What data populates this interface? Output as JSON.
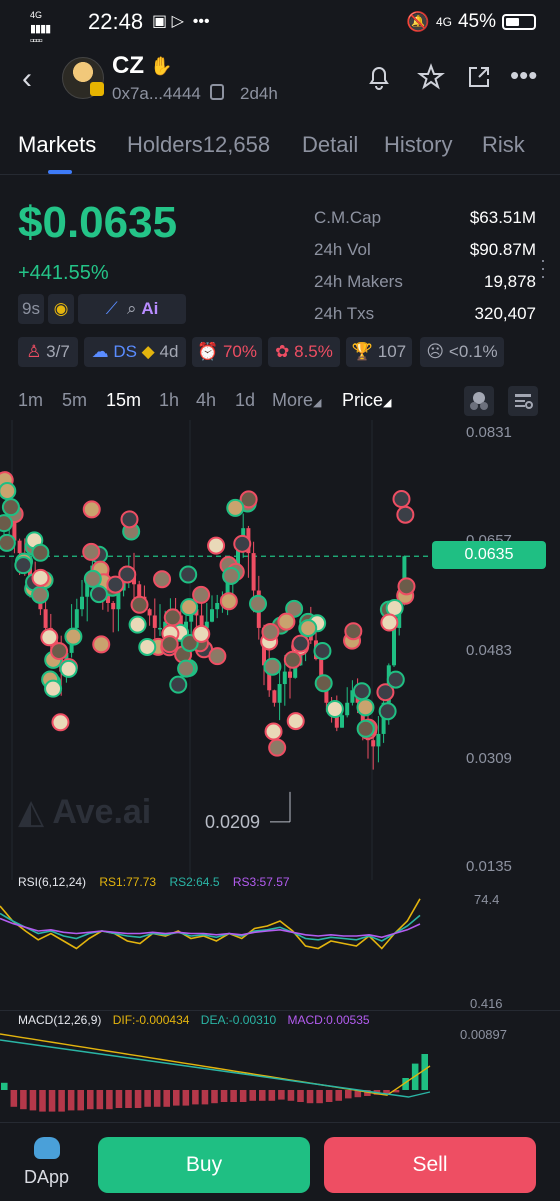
{
  "status_bar": {
    "network": "4G",
    "time": "22:48",
    "network_right": "4G",
    "battery": "45%"
  },
  "header": {
    "name": "CZ",
    "address": "0x7a...4444",
    "age": "2d4h"
  },
  "tabs": [
    "Markets",
    "Holders12,658",
    "Detail",
    "History",
    "Risk"
  ],
  "market": {
    "price": "$0.0635",
    "change": "+441.55%",
    "stats": [
      {
        "label": "C.M.Cap",
        "value": "$63.51M"
      },
      {
        "label": "24h Vol",
        "value": "$90.87M"
      },
      {
        "label": "24h Makers",
        "value": "19,878"
      },
      {
        "label": "24h Txs",
        "value": "320,407"
      }
    ]
  },
  "badges": {
    "age_badge": "9s",
    "ai_label": "Ai",
    "holders_ratio": "3/7",
    "ds_label": "DS",
    "ds_age": "4d",
    "top_pct": "70%",
    "bundle_pct": "8.5%",
    "trophy": "107",
    "dev_pct": "<0.1%"
  },
  "timeframes": {
    "items": [
      "1m",
      "5m",
      "15m",
      "1h",
      "4h",
      "1d"
    ],
    "active": "15m",
    "more": "More",
    "price": "Price"
  },
  "chart_main": {
    "axis": [
      "0.0831",
      "0.0657",
      "0.0635",
      "0.0483",
      "0.0309",
      "0.0135"
    ],
    "current_price": "0.0635",
    "low_marker": "0.0209",
    "low_y": 0.0209,
    "watermark": "Ave.ai"
  },
  "chart_data": [
    {
      "type": "line",
      "title": "RSI(6,12,24)",
      "legend": [
        "RS1:77.73",
        "RS2:64.5",
        "RS3:57.57"
      ],
      "axis": [
        "74.4",
        "0.416"
      ],
      "series": [
        {
          "name": "RS1",
          "color": "#e3b40e",
          "values": [
            72,
            60,
            52,
            45,
            50,
            44,
            38,
            46,
            52,
            50,
            44,
            42,
            50,
            48,
            52,
            46,
            48,
            44,
            50,
            46,
            54,
            56,
            60,
            52,
            40,
            38,
            44,
            42,
            40,
            48,
            38,
            50,
            60,
            77.73
          ]
        },
        {
          "name": "RS2",
          "color": "#2ab5a5",
          "values": [
            66,
            60,
            55,
            50,
            52,
            48,
            46,
            50,
            52,
            50,
            48,
            47,
            50,
            49,
            51,
            48,
            49,
            47,
            50,
            48,
            52,
            53,
            55,
            51,
            46,
            45,
            47,
            46,
            45,
            48,
            44,
            50,
            56,
            64.5
          ]
        },
        {
          "name": "RS3",
          "color": "#b35cf0",
          "values": [
            62,
            58,
            55,
            52,
            53,
            51,
            50,
            51,
            52,
            51,
            50,
            50,
            51,
            50,
            51,
            50,
            50,
            49,
            50,
            49,
            51,
            52,
            53,
            51,
            49,
            48,
            49,
            48,
            48,
            49,
            47,
            50,
            53,
            57.57
          ]
        }
      ]
    },
    {
      "type": "bar",
      "title": "MACD(12,26,9)",
      "legend": [
        "DIF:-0.000434",
        "DEA:-0.00310",
        "MACD:0.00535"
      ],
      "axis": [
        "0.00897"
      ],
      "values": [
        0.6,
        -1.4,
        -1.6,
        -1.7,
        -1.8,
        -1.8,
        -1.8,
        -1.7,
        -1.7,
        -1.6,
        -1.6,
        -1.6,
        -1.5,
        -1.5,
        -1.5,
        -1.4,
        -1.4,
        -1.4,
        -1.3,
        -1.3,
        -1.2,
        -1.2,
        -1.1,
        -1.0,
        -1.0,
        -1.0,
        -0.9,
        -0.9,
        -0.9,
        -0.8,
        -0.9,
        -1.0,
        -1.1,
        -1.1,
        -1.0,
        -0.9,
        -0.7,
        -0.6,
        -0.5,
        -0.4,
        -0.3,
        -0.2,
        1.0,
        2.2,
        3.0
      ]
    }
  ],
  "footer": {
    "dapp": "DApp",
    "buy": "Buy",
    "sell": "Sell"
  }
}
